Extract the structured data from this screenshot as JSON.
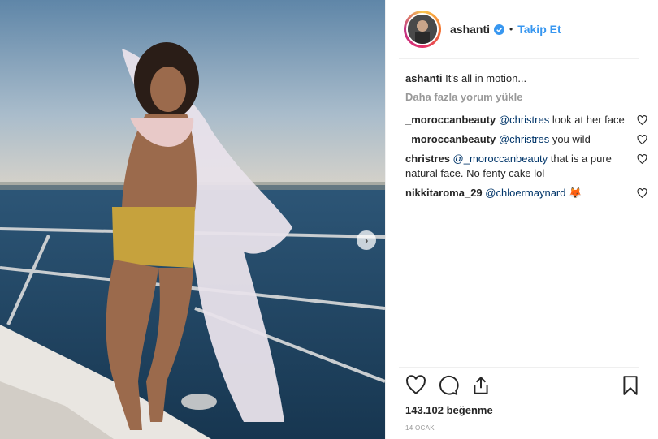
{
  "post": {
    "username": "ashanti",
    "follow_label": "Takip Et",
    "caption_user": "ashanti",
    "caption_text": "It's all in motion...",
    "load_more_label": "Daha fazla yorum yükle",
    "likes_text": "143.102 beğenme",
    "date_text": "14 OCAK"
  },
  "comments": [
    {
      "user": "_moroccanbeauty",
      "mention": "@christres",
      "text": " look at her face"
    },
    {
      "user": "_moroccanbeauty",
      "mention": "@christres",
      "text": " you wild"
    },
    {
      "user": "christres",
      "mention": "@_moroccanbeauty",
      "text": " that is a pure natural face. No fenty cake lol"
    },
    {
      "user": "nikkitaroma_29",
      "mention": "@chloermaynard",
      "text": " 🦊"
    }
  ],
  "icons": {
    "verified": "verified-badge-icon",
    "like": "heart-icon",
    "comment": "comment-icon",
    "share": "share-icon",
    "save": "bookmark-icon",
    "next": "chevron-right-icon"
  },
  "colors": {
    "link_blue": "#3897f0",
    "mention": "#003569",
    "muted": "#999999",
    "text": "#262626"
  }
}
